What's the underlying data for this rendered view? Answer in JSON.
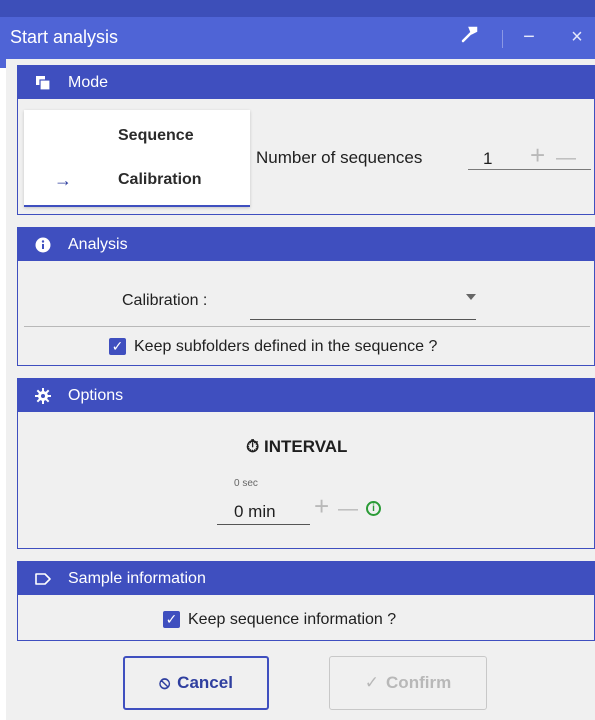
{
  "window": {
    "title": "Start analysis",
    "controls": {
      "pin_icon": "hammer-icon",
      "minimize": "−",
      "close": "×"
    }
  },
  "colors": {
    "title_bar": "#4f64d6",
    "section_header": "#3f4fbf",
    "dialog_bg": "#f0f0f0",
    "info_green": "#2a9b36"
  },
  "sections": {
    "mode": {
      "title": "Mode",
      "icon": "layers-icon",
      "tabs": [
        {
          "label": "Sequence",
          "selected": false
        },
        {
          "label": "Calibration",
          "selected": true,
          "indicator": "→"
        }
      ],
      "count_label": "Number of sequences",
      "count_value": "1",
      "increment": "+",
      "decrement": "—"
    },
    "analysis": {
      "title": "Analysis",
      "icon": "info-circle-icon",
      "calibration_label": "Calibration :",
      "calibration_value": "",
      "keep_subfolders_label": "Keep subfolders defined in the sequence ?",
      "keep_subfolders_checked": true
    },
    "options": {
      "title": "Options",
      "icon": "gear-icon",
      "interval_title": "INTERVAL",
      "interval_icon": "⏱",
      "interval_sub": "0 sec",
      "interval_value": "0 min",
      "increment": "+",
      "decrement": "—",
      "info_glyph": "i"
    },
    "sample_info": {
      "title": "Sample information",
      "icon": "tag-icon",
      "keep_seq_label": "Keep sequence information ?",
      "keep_seq_checked": true
    }
  },
  "footer": {
    "cancel_label": "Cancel",
    "cancel_icon": "⦸",
    "confirm_label": "Confirm",
    "confirm_icon": "✓",
    "confirm_enabled": false
  }
}
